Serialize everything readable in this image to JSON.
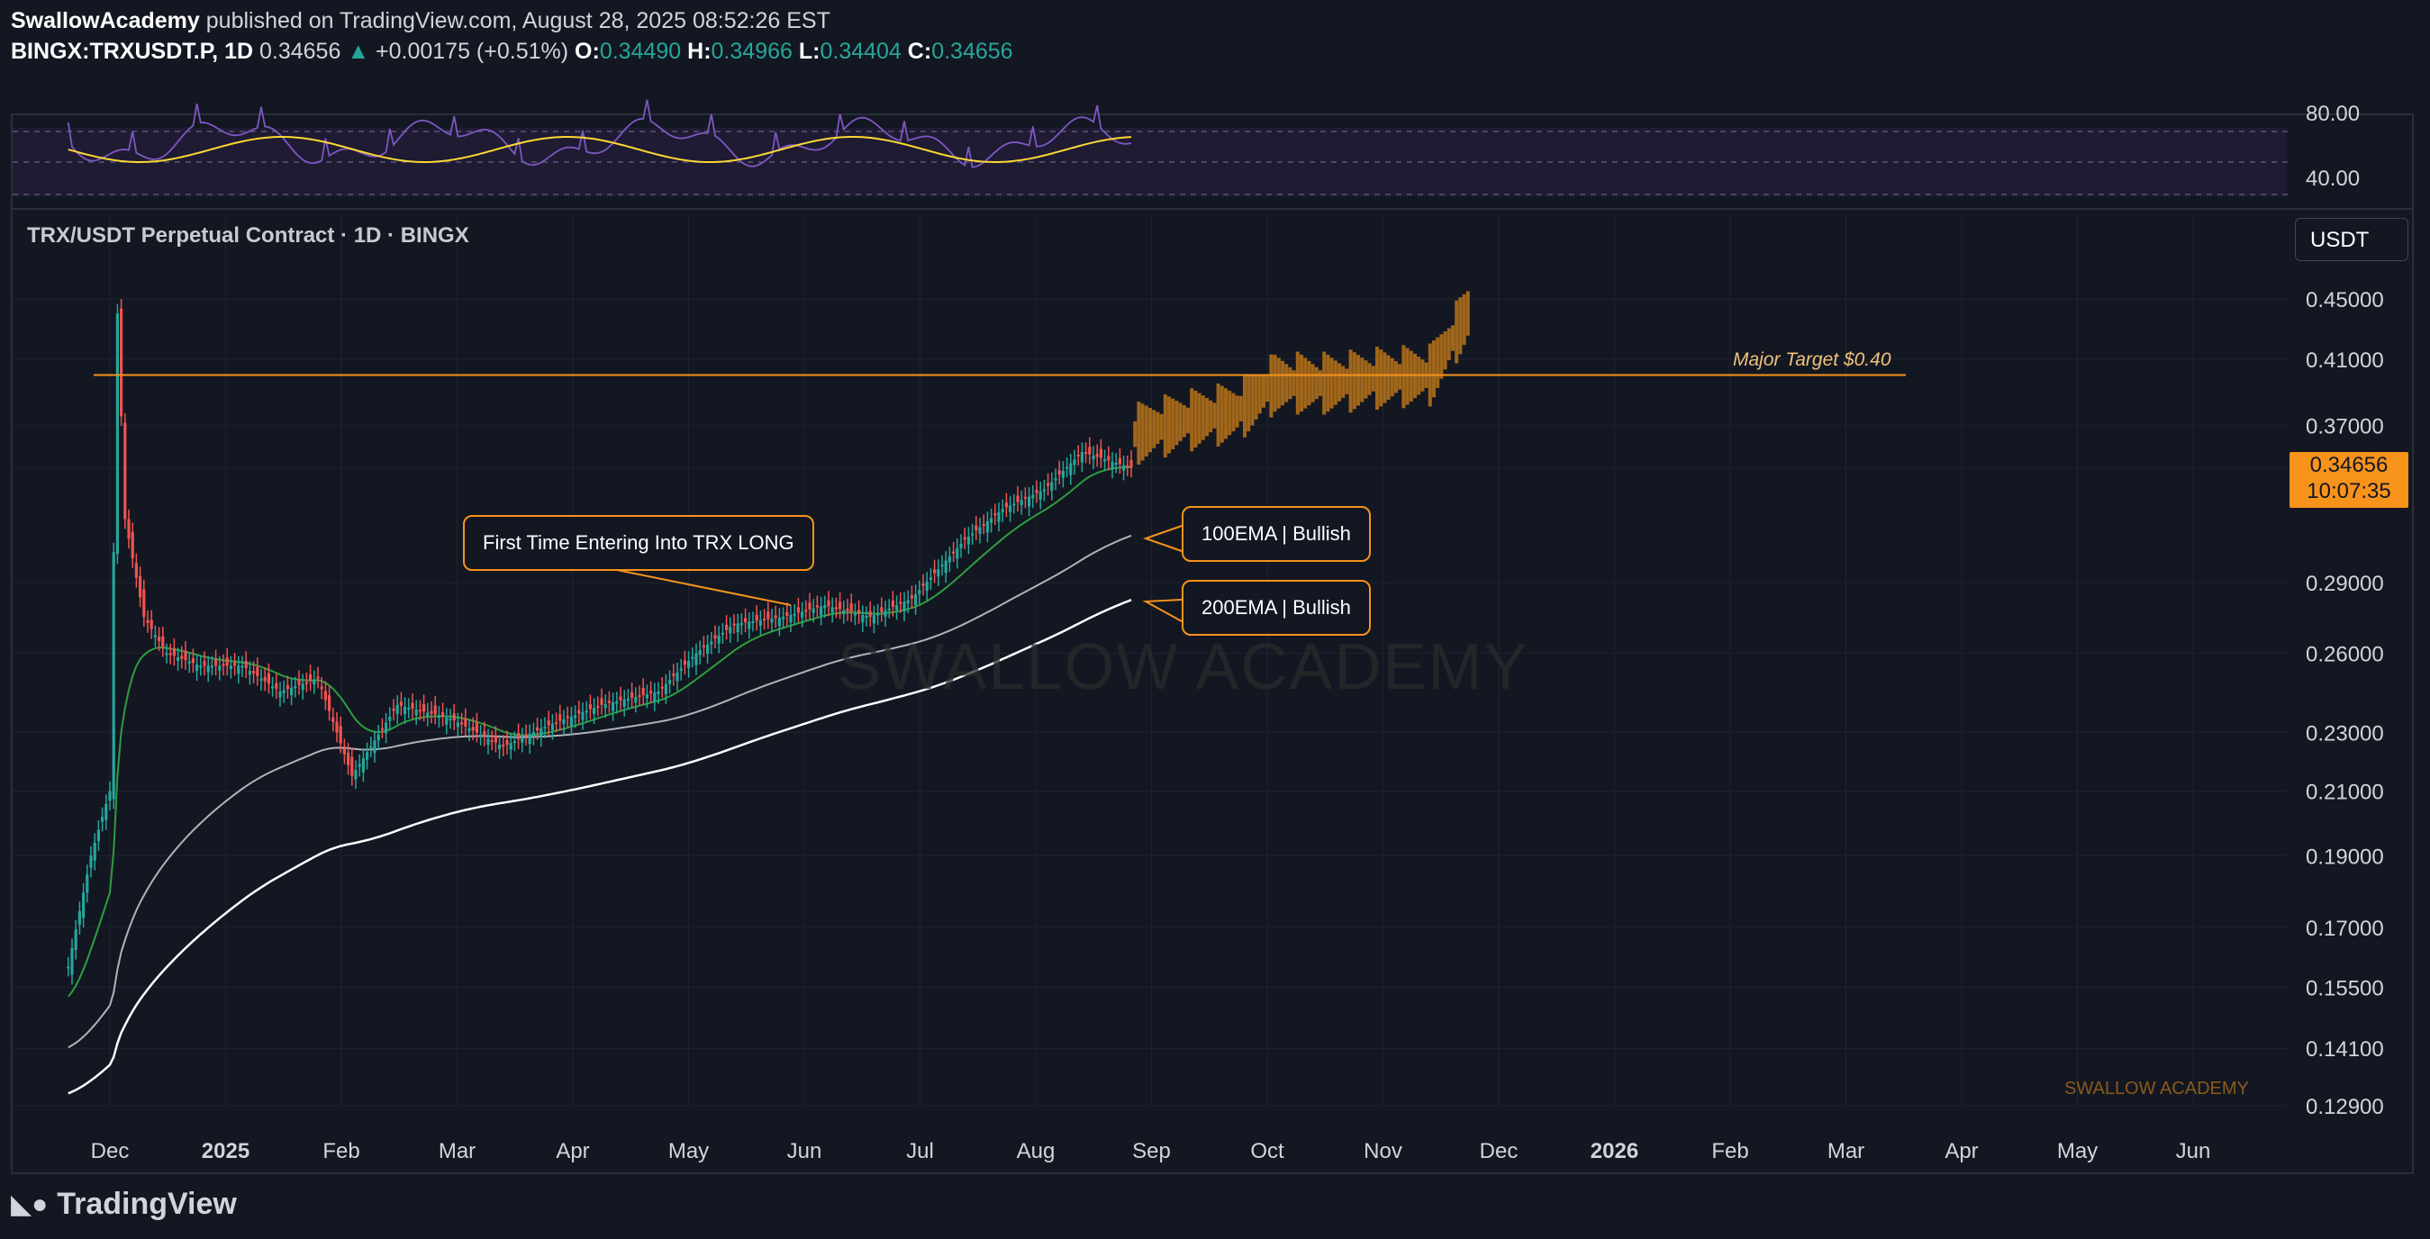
{
  "header": {
    "author": "SwallowAcademy",
    "published": "published on TradingView.com, August 28, 2025 08:52:26 EST",
    "symbol": "BINGX:TRXUSDT.P, 1D",
    "last": "0.34656",
    "change": "+0.00175 (+0.51%)",
    "open_label": "O:",
    "open": "0.34490",
    "high_label": "H:",
    "high": "0.34966",
    "low_label": "L:",
    "low": "0.34404",
    "close_label": "C:",
    "close": "0.34656"
  },
  "chart_title": "TRX/USDT Perpetual Contract · 1D · BINGX",
  "currency": "USDT",
  "price_tag": {
    "price": "0.34656",
    "countdown": "10:07:35"
  },
  "annotations": {
    "entry": "First Time Entering Into TRX LONG",
    "ema100": "100EMA | Bullish",
    "ema200": "200EMA | Bullish",
    "target": "Major Target $0.40"
  },
  "watermark": "SWALLOW ACADEMY",
  "watermark_small": "SWALLOW ACADEMY",
  "footer_brand": "TradingView",
  "colors": {
    "background": "#131722",
    "accent": "#f7931a",
    "up": "#26a69a",
    "down": "#ef5350",
    "rsi": "#7e57c2",
    "rsi_ma": "#fdd835"
  },
  "chart_data": {
    "type": "candlestick",
    "price_scale": "log",
    "y_ticks": [
      "0.45000",
      "0.41000",
      "0.37000",
      "0.34656",
      "0.29000",
      "0.26000",
      "0.23000",
      "0.21000",
      "0.19000",
      "0.17000",
      "0.15500",
      "0.14100",
      "0.12900"
    ],
    "x_ticks": [
      "Dec",
      "2025",
      "Feb",
      "Mar",
      "Apr",
      "May",
      "Jun",
      "Jul",
      "Aug",
      "Sep",
      "Oct",
      "Nov",
      "Dec",
      "2026",
      "Feb",
      "Mar",
      "Apr",
      "May",
      "Jun"
    ],
    "series": [
      {
        "name": "TRXUSDT.P",
        "points": [
          [
            "2024-11-20",
            0.16
          ],
          [
            "2024-11-26",
            0.19
          ],
          [
            "2024-12-01",
            0.21
          ],
          [
            "2024-12-03",
            0.44
          ],
          [
            "2024-12-05",
            0.32
          ],
          [
            "2024-12-10",
            0.275
          ],
          [
            "2024-12-16",
            0.26
          ],
          [
            "2024-12-25",
            0.255
          ],
          [
            "2025-01-05",
            0.255
          ],
          [
            "2025-01-15",
            0.245
          ],
          [
            "2025-01-25",
            0.25
          ],
          [
            "2025-02-03",
            0.215
          ],
          [
            "2025-02-15",
            0.24
          ],
          [
            "2025-03-01",
            0.235
          ],
          [
            "2025-03-15",
            0.225
          ],
          [
            "2025-03-26",
            0.232
          ],
          [
            "2025-04-10",
            0.24
          ],
          [
            "2025-04-25",
            0.245
          ],
          [
            "2025-05-05",
            0.26
          ],
          [
            "2025-05-15",
            0.272
          ],
          [
            "2025-05-28",
            0.275
          ],
          [
            "2025-06-08",
            0.28
          ],
          [
            "2025-06-20",
            0.275
          ],
          [
            "2025-07-01",
            0.283
          ],
          [
            "2025-07-15",
            0.31
          ],
          [
            "2025-07-25",
            0.325
          ],
          [
            "2025-08-05",
            0.335
          ],
          [
            "2025-08-15",
            0.355
          ],
          [
            "2025-08-28",
            0.34656
          ]
        ]
      },
      {
        "name": "Projection",
        "points": [
          [
            "2025-08-29",
            0.365
          ],
          [
            "2025-09-10",
            0.372
          ],
          [
            "2025-09-25",
            0.378
          ],
          [
            "2025-10-05",
            0.395
          ],
          [
            "2025-10-20",
            0.395
          ],
          [
            "2025-11-01",
            0.398
          ],
          [
            "2025-11-15",
            0.4
          ],
          [
            "2025-11-25",
            0.44
          ]
        ]
      }
    ],
    "indicators": {
      "rsi_ticks": [
        "80.00",
        "40.00"
      ],
      "ema": [
        "EMA20",
        "EMA100",
        "EMA200"
      ]
    },
    "horizontal_line": {
      "label": "Major Target $0.40",
      "value": 0.4
    }
  }
}
